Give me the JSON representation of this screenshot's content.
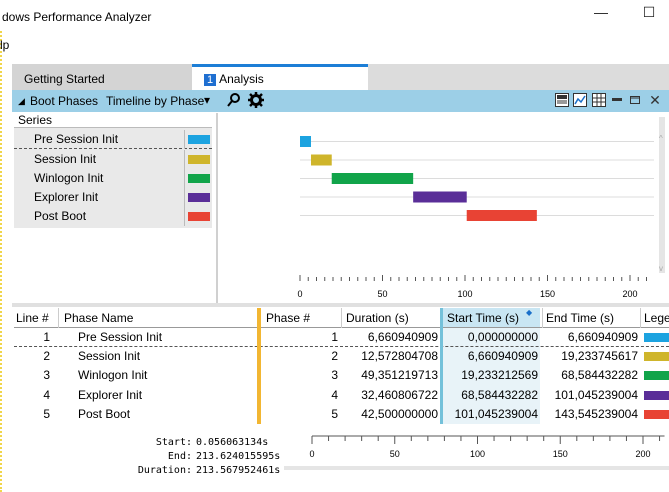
{
  "window": {
    "title": "dows Performance Analyzer",
    "minimize_glyph": "—",
    "maximize_glyph": "☐"
  },
  "menu": {
    "first_item": "lp"
  },
  "tabs": [
    {
      "label": "Getting Started"
    },
    {
      "num": "1",
      "label": "Analysis"
    }
  ],
  "toolbar": {
    "collapse_glyph": "◢",
    "graph_name": "Boot Phases",
    "view_selector": "Timeline by Phase",
    "dropdown_glyph": "▾",
    "search_icon": "search-icon",
    "settings_icon": "gear-icon",
    "right_icons": [
      "grid-view-icon",
      "graph-view-icon",
      "table-view-icon",
      "graph-only-icon",
      "minimize-icon",
      "close-icon"
    ]
  },
  "series": {
    "header": "Series",
    "items": [
      {
        "name": "Pre Session Init",
        "color": "#1ca3e0"
      },
      {
        "name": "Session Init",
        "color": "#cfb52b"
      },
      {
        "name": "Winlogon Init",
        "color": "#11a44a"
      },
      {
        "name": "Explorer Init",
        "color": "#5a2e98"
      },
      {
        "name": "Post Boot",
        "color": "#e84334"
      }
    ]
  },
  "chart_data": {
    "type": "bar",
    "orientation": "horizontal-gantt",
    "x_ticks": [
      0,
      50,
      100,
      150,
      200
    ],
    "xlim": [
      0,
      213.6
    ],
    "series": [
      {
        "name": "Pre Session Init",
        "start": 0.0,
        "end": 6.660940909
      },
      {
        "name": "Session Init",
        "start": 6.660940909,
        "end": 19.233745617
      },
      {
        "name": "Winlogon Init",
        "start": 19.233212569,
        "end": 68.584432282
      },
      {
        "name": "Explorer Init",
        "start": 68.584432282,
        "end": 101.045239004
      },
      {
        "name": "Post Boot",
        "start": 101.045239004,
        "end": 143.545239004
      }
    ]
  },
  "table": {
    "headers": [
      "Line #",
      "Phase Name",
      "Phase #",
      "Duration (s)",
      "Start Time (s)",
      "End Time (s)",
      "Lege"
    ],
    "rows": [
      {
        "line": "1",
        "name": "Pre Session Init",
        "phase": "1",
        "duration": "6,660940909",
        "start": "0,000000000",
        "end": "6,660940909",
        "color": "#1ca3e0"
      },
      {
        "line": "2",
        "name": "Session Init",
        "phase": "2",
        "duration": "12,572804708",
        "start": "6,660940909",
        "end": "19,233745617",
        "color": "#cfb52b"
      },
      {
        "line": "3",
        "name": "Winlogon Init",
        "phase": "3",
        "duration": "49,351219713",
        "start": "19,233212569",
        "end": "68,584432282",
        "color": "#11a44a"
      },
      {
        "line": "4",
        "name": "Explorer Init",
        "phase": "4",
        "duration": "32,460806722",
        "start": "68,584432282",
        "end": "101,045239004",
        "color": "#5a2e98"
      },
      {
        "line": "5",
        "name": "Post Boot",
        "phase": "5",
        "duration": "42,500000000",
        "start": "101,045239004",
        "end": "143,545239004",
        "color": "#e84334"
      }
    ]
  },
  "footer": {
    "start_label": "Start:",
    "start_value": "0.056063134s",
    "end_label": "End:",
    "end_value": "213.624015595s",
    "duration_label": "Duration:",
    "duration_value": "213.567952461s",
    "ticks": [
      0,
      50,
      100,
      150,
      200
    ]
  }
}
